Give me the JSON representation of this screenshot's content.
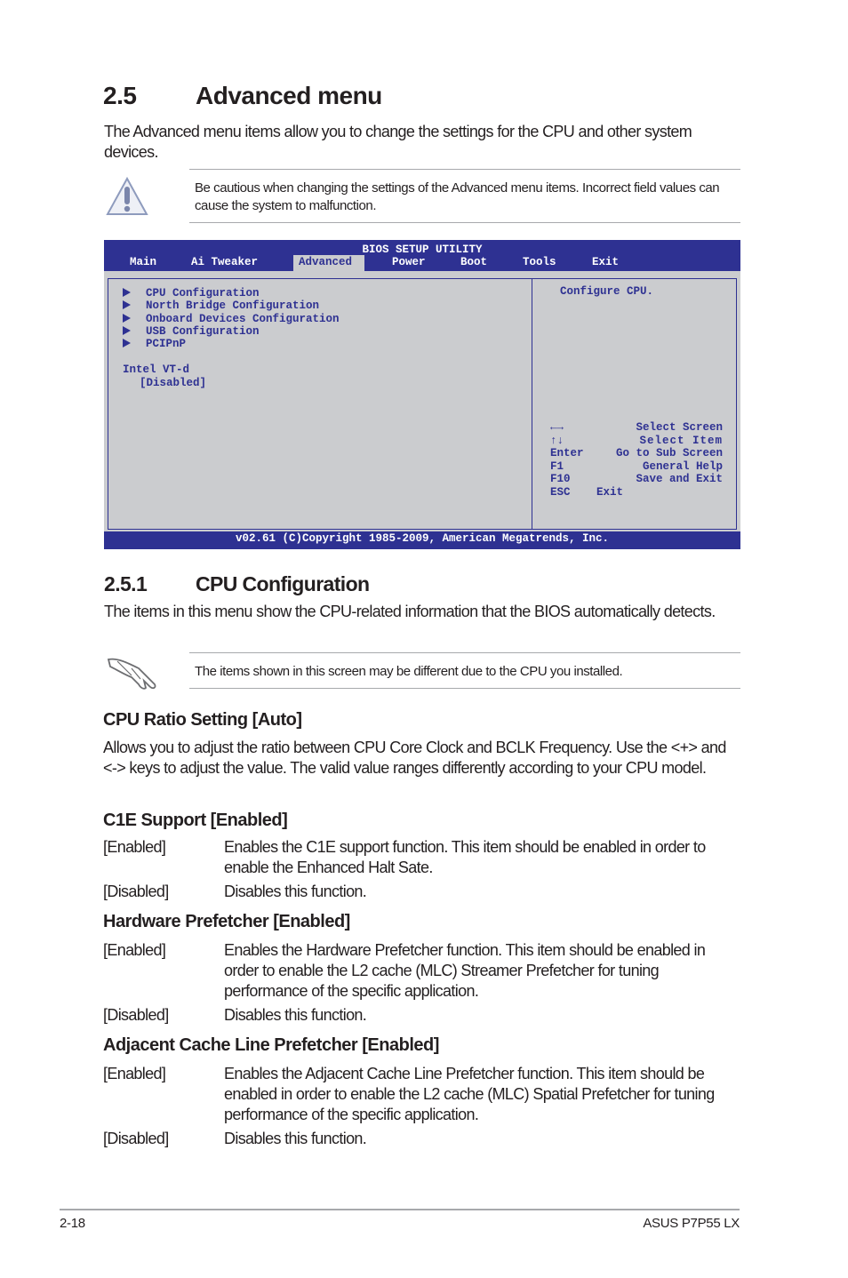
{
  "section": {
    "number": "2.5",
    "title": "Advanced menu",
    "intro": "The Advanced menu items allow you to change the settings for the CPU and other system devices."
  },
  "caution": {
    "icon": "warning-icon",
    "text": "Be cautious when changing the settings of the Advanced menu items. Incorrect field values can cause the system to malfunction."
  },
  "bios": {
    "title": "BIOS SETUP UTILITY",
    "tabs": [
      "Main",
      "Ai Tweaker",
      "Advanced",
      "Power",
      "Boot",
      "Tools",
      "Exit"
    ],
    "active_tab": "Advanced",
    "items": [
      "CPU Configuration",
      "North Bridge Configuration",
      "Onboard Devices Configuration",
      "USB Configuration",
      "PCIPnP"
    ],
    "setting_label": "Intel VT-d",
    "setting_value": "[Disabled]",
    "help": "Configure CPU.",
    "keys": [
      {
        "key": "←→",
        "action": "Select Screen"
      },
      {
        "key": "↑↓",
        "action": "Select Item"
      },
      {
        "key": "Enter",
        "action": "Go to Sub Screen"
      },
      {
        "key": "F1",
        "action": "General Help"
      },
      {
        "key": "F10",
        "action": "Save and Exit"
      },
      {
        "key": "ESC",
        "action": "Exit"
      }
    ],
    "footer": "v02.61 (C)Copyright 1985-2009, American Megatrends, Inc.",
    "colors": {
      "blue": "#2e3192",
      "gray": "#cbcccf"
    }
  },
  "subsection": {
    "number": "2.5.1",
    "title": "CPU Configuration",
    "intro": "The items in this menu show the CPU-related information that the BIOS automatically detects."
  },
  "note": {
    "icon": "hand-pointing-icon",
    "text": "The items shown in this screen may be different due to the CPU you installed."
  },
  "settings": [
    {
      "title": "CPU Ratio Setting [Auto]",
      "text": "Allows you to adjust the ratio between CPU Core Clock and BCLK Frequency. Use the <+> and <-> keys to adjust the value. The valid value ranges differently according to your CPU model."
    },
    {
      "title": "C1E Support [Enabled]",
      "options": [
        {
          "key": "[Enabled]",
          "desc": "Enables the C1E support function. This item should be enabled in order to enable the Enhanced Halt Sate."
        },
        {
          "key": "[Disabled]",
          "desc": "Disables this function."
        }
      ]
    },
    {
      "title": "Hardware Prefetcher [Enabled]",
      "options": [
        {
          "key": "[Enabled]",
          "desc": "Enables the Hardware Prefetcher function. This item should be enabled  in order to enable the L2 cache (MLC) Streamer Prefetcher for tuning performance of the specific application."
        },
        {
          "key": "[Disabled]",
          "desc": "Disables this function."
        }
      ]
    },
    {
      "title": "Adjacent Cache Line Prefetcher [Enabled]",
      "options": [
        {
          "key": "[Enabled]",
          "desc": "Enables the Adjacent Cache Line Prefetcher function. This item should be enabled in order to enable the L2 cache (MLC) Spatial Prefetcher for tuning performance of the specific application."
        },
        {
          "key": "[Disabled]",
          "desc": "Disables this function."
        }
      ]
    }
  ],
  "footer": {
    "page": "2-18",
    "product": "ASUS P7P55 LX"
  }
}
